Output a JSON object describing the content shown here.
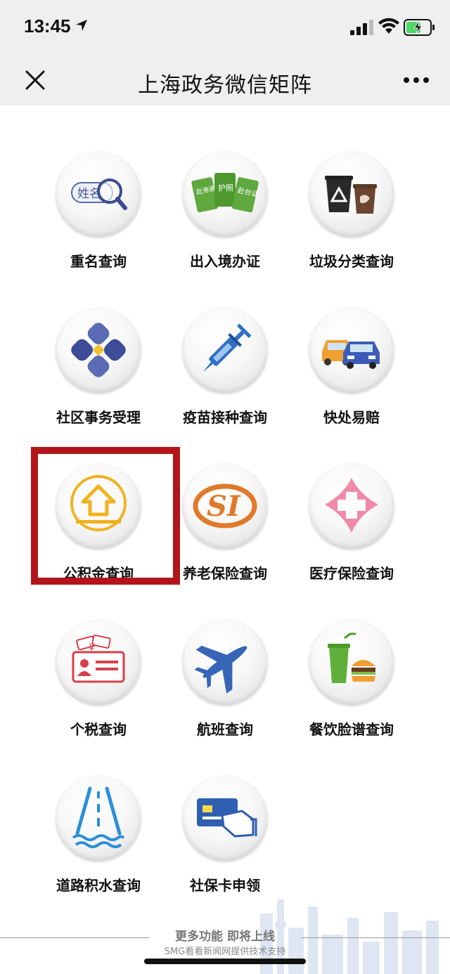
{
  "status": {
    "time": "13:45"
  },
  "nav": {
    "title": "上海政务微信矩阵"
  },
  "services": [
    {
      "label": "重名查询",
      "icon": "name-search-icon",
      "icon_text": "姓名"
    },
    {
      "label": "出入境办证",
      "icon": "passport-cards-icon",
      "icon_text": [
        "赴港通行证",
        "护照",
        "赴台证"
      ]
    },
    {
      "label": "垃圾分类查询",
      "icon": "trash-bins-icon"
    },
    {
      "label": "社区事务受理",
      "icon": "community-diamond-icon"
    },
    {
      "label": "疫苗接种查询",
      "icon": "syringe-icon"
    },
    {
      "label": "快处易赔",
      "icon": "cars-icon"
    },
    {
      "label": "公积金查询",
      "icon": "housing-fund-icon"
    },
    {
      "label": "养老保险查询",
      "icon": "pension-si-icon",
      "icon_text": "SI"
    },
    {
      "label": "医疗保险查询",
      "icon": "medical-cross-icon"
    },
    {
      "label": "个税查询",
      "icon": "income-tax-icon",
      "icon_text": "¥"
    },
    {
      "label": "航班查询",
      "icon": "airplane-icon"
    },
    {
      "label": "餐饮脸谱查询",
      "icon": "food-drink-icon"
    },
    {
      "label": "道路积水查询",
      "icon": "road-water-icon"
    },
    {
      "label": "社保卡申领",
      "icon": "social-card-icon"
    }
  ],
  "footer": {
    "main": "更多功能 即将上线",
    "sub": "SMG看看新闻网提供技术支持"
  },
  "colors": {
    "highlight": "#b3151a",
    "status_bg": "#efefef"
  }
}
